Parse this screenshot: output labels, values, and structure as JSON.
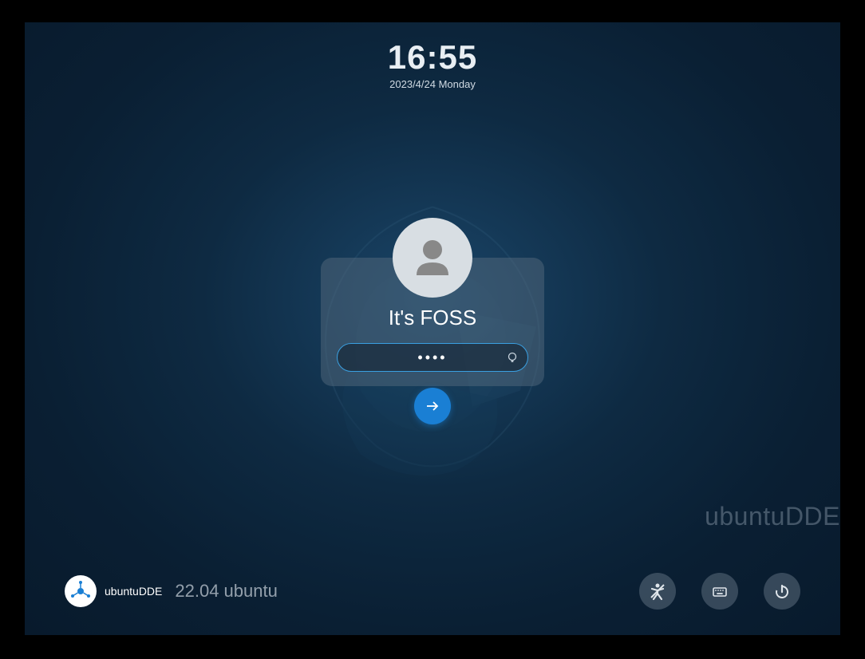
{
  "clock": {
    "time": "16:55",
    "date": "2023/4/24 Monday"
  },
  "login": {
    "username": "It's FOSS",
    "password_value": "••••"
  },
  "watermark": "ubuntuDDE",
  "distro": {
    "name": "ubuntuDDE",
    "version": "22.04 ubuntu"
  },
  "icons": {
    "avatar": "user-avatar-icon",
    "hint": "lightbulb-icon",
    "arrow": "arrow-right-icon",
    "logo": "deepin-logo-icon",
    "accessibility": "accessibility-icon",
    "keyboard": "keyboard-icon",
    "power": "power-icon"
  }
}
